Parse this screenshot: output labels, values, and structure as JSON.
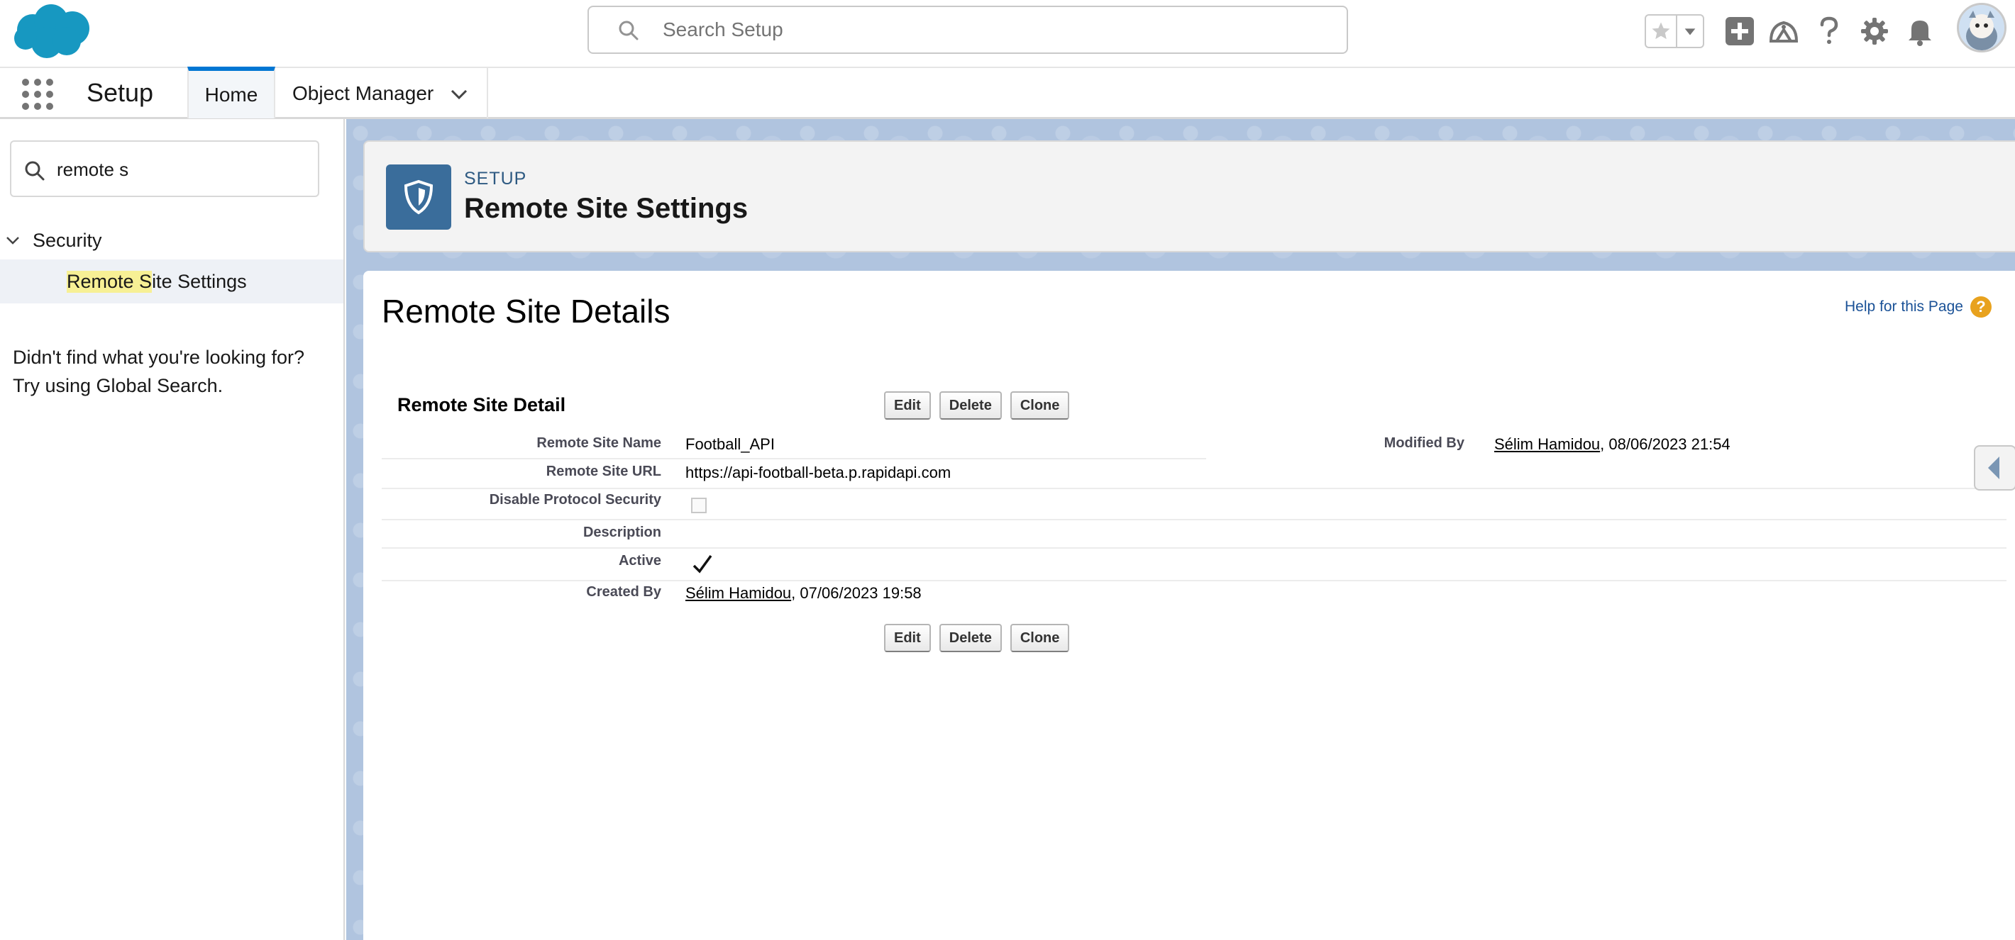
{
  "header": {
    "search_placeholder": "Search Setup",
    "icons": [
      "salesforce-cloud-logo",
      "favorites-star-icon",
      "favorites-dropdown-icon",
      "global-actions-plus-icon",
      "trailhead-icon",
      "help-icon",
      "setup-gear-icon",
      "notifications-bell-icon",
      "user-avatar"
    ]
  },
  "context_bar": {
    "app_name": "Setup",
    "tabs": [
      {
        "label": "Home",
        "active": true
      },
      {
        "label": "Object Manager",
        "active": false
      }
    ]
  },
  "sidebar": {
    "quickfind_value": "remote s",
    "section_label": "Security",
    "item_highlight": "Remote S",
    "item_rest": "ite Settings",
    "not_found_line1": "Didn't find what you're looking for?",
    "not_found_line2": "Try using Global Search."
  },
  "page_header": {
    "eyebrow": "SETUP",
    "title": "Remote Site Settings"
  },
  "content": {
    "title": "Remote Site Details",
    "help_link": "Help for this Page",
    "detail_heading": "Remote Site Detail",
    "buttons": {
      "edit": "Edit",
      "delete": "Delete",
      "clone": "Clone"
    },
    "fields": {
      "remote_site_name_label": "Remote Site Name",
      "remote_site_name_value": "Football_API",
      "remote_site_url_label": "Remote Site URL",
      "remote_site_url_value": "https://api-football-beta.p.rapidapi.com",
      "disable_protocol_security_label": "Disable Protocol Security",
      "disable_protocol_security_checked": false,
      "description_label": "Description",
      "description_value": "",
      "active_label": "Active",
      "active_checked": true,
      "created_by_label": "Created By",
      "created_by_user": "Sélim Hamidou",
      "created_by_date": ", 07/06/2023 19:58",
      "modified_by_label": "Modified By",
      "modified_by_user": "Sélim Hamidou",
      "modified_by_date": ", 08/06/2023 21:54"
    }
  },
  "colors": {
    "brand_blue": "#0176d3",
    "setup_icon_bg": "#3a6d9b",
    "help_icon": "#e8a21e",
    "highlight": "#fff03f"
  }
}
